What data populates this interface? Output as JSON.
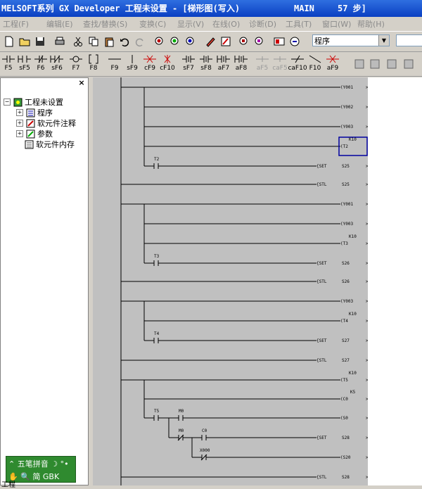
{
  "window": {
    "title": "MELSOFT系列 GX Developer 工程未设置 - [梯形图(写入)",
    "program": "MAIN",
    "steps": "57 步]"
  },
  "menu": [
    "工程(F)",
    "编辑(E)",
    "查找/替换(S)",
    "变换(C)",
    "显示(V)",
    "在线(O)",
    "诊断(D)",
    "工具(T)",
    "窗口(W)",
    "帮助(H)"
  ],
  "toolbar": {
    "combo_value": "程序"
  },
  "ladder_keys": [
    "F5",
    "sF5",
    "F6",
    "sF6",
    "F7",
    "F8",
    "F9",
    "sF9",
    "cF9",
    "cF10",
    "sF7",
    "sF8",
    "aF7",
    "aF8",
    "aF5",
    "caF5",
    "caF10",
    "F10",
    "aF9"
  ],
  "tree": {
    "root": "工程未设置",
    "items": [
      "程序",
      "软元件注释",
      "参数",
      "软元件内存"
    ]
  },
  "ladder": {
    "rungs": [
      {
        "contacts": [],
        "coils": [
          {
            "text": "(Y001"
          }
        ]
      },
      {
        "coils": [
          {
            "text": "(Y002"
          }
        ]
      },
      {
        "coils": [
          {
            "text": "(Y003"
          }
        ]
      },
      {
        "coils": [
          {
            "text": "(T2",
            "k": "K10"
          }
        ]
      },
      {
        "contact": "T2",
        "inst": "{SET",
        "op": "S25"
      },
      {
        "inst": "{STL",
        "op": "S25"
      },
      {
        "coils": [
          {
            "text": "(Y001"
          }
        ]
      },
      {
        "coils": [
          {
            "text": "(Y003"
          }
        ]
      },
      {
        "coils": [
          {
            "text": "(T3",
            "k": "K10"
          }
        ]
      },
      {
        "contact": "T3",
        "inst": "{SET",
        "op": "S26"
      },
      {
        "inst": "{STL",
        "op": "S26"
      },
      {
        "coils": [
          {
            "text": "(Y003"
          }
        ]
      },
      {
        "coils": [
          {
            "text": "(T4",
            "k": "K10"
          }
        ]
      },
      {
        "contact": "T4",
        "inst": "{SET",
        "op": "S27"
      },
      {
        "inst": "{STL",
        "op": "S27"
      },
      {
        "coils": [
          {
            "text": "(T5",
            "k": "K10"
          }
        ]
      },
      {
        "coils": [
          {
            "text": "(C0",
            "k": "K5"
          }
        ]
      },
      {
        "contacts2": [
          "T5",
          "M0"
        ],
        "coils": [
          {
            "text": "(S0"
          }
        ]
      },
      {
        "contacts2": [
          "M0",
          "C0"
        ],
        "inst": "{SET",
        "op": "S28"
      },
      {
        "contact": "X000",
        "coils": [
          {
            "text": "(S20"
          }
        ]
      },
      {
        "inst": "{STL",
        "op": "S28"
      }
    ],
    "labels": {
      "y001": "(Y001",
      "y002": "(Y002",
      "y003": "(Y003",
      "t2": "(T2",
      "k10": "K10",
      "c_t2": "T2",
      "set": "{SET",
      "s25": "S25",
      "stl": "{STL",
      "t3": "(T3",
      "c_t3": "T3",
      "s26": "S26",
      "t4": "(T4",
      "c_t4": "T4",
      "s27": "S27",
      "t5": "(T5",
      "c0": "(C0",
      "k5": "K5",
      "c_t5": "T5",
      "c_m0": "M0",
      "s0": "(S0",
      "c_c0": "C0",
      "s28": "S28",
      "c_x000": "X000",
      "s20": "(S20"
    }
  },
  "ime": {
    "name": "五笔拼音",
    "mode": "简 GBK"
  },
  "bottom_label": "工程"
}
